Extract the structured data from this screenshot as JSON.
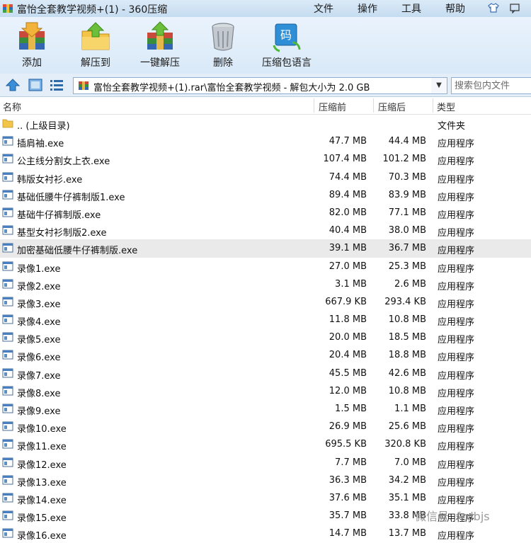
{
  "window": {
    "title": "富怡全套教学视频+(1) - 360压缩",
    "menus": [
      "文件",
      "操作",
      "工具",
      "帮助"
    ]
  },
  "toolbar": [
    {
      "label": "添加",
      "icon": "add-archive-icon"
    },
    {
      "label": "解压到",
      "icon": "extract-to-icon"
    },
    {
      "label": "一键解压",
      "icon": "one-click-extract-icon"
    },
    {
      "label": "删除",
      "icon": "trash-icon"
    },
    {
      "label": "压缩包语言",
      "icon": "archive-language-icon"
    }
  ],
  "address": {
    "path": "富怡全套教学视频+(1).rar\\富怡全套教学视频 - 解包大小为 2.0 GB",
    "search_placeholder": "搜索包内文件"
  },
  "columns": {
    "name": "名称",
    "original": "压缩前",
    "compressed": "压缩后",
    "type": "类型"
  },
  "rows": [
    {
      "name": ".. (上级目录)",
      "original": "",
      "compressed": "",
      "type": "文件夹",
      "kind": "folder"
    },
    {
      "name": "插肩袖.exe",
      "original": "47.7 MB",
      "compressed": "44.4 MB",
      "type": "应用程序",
      "kind": "exe"
    },
    {
      "name": "公主线分割女上衣.exe",
      "original": "107.4 MB",
      "compressed": "101.2 MB",
      "type": "应用程序",
      "kind": "exe"
    },
    {
      "name": "韩版女衬衫.exe",
      "original": "74.4 MB",
      "compressed": "70.3 MB",
      "type": "应用程序",
      "kind": "exe"
    },
    {
      "name": "基础低腰牛仔裤制版1.exe",
      "original": "89.4 MB",
      "compressed": "83.9 MB",
      "type": "应用程序",
      "kind": "exe"
    },
    {
      "name": "基础牛仔裤制版.exe",
      "original": "82.0 MB",
      "compressed": "77.1 MB",
      "type": "应用程序",
      "kind": "exe"
    },
    {
      "name": "基型女衬衫制版2.exe",
      "original": "40.4 MB",
      "compressed": "38.0 MB",
      "type": "应用程序",
      "kind": "exe"
    },
    {
      "name": "加密基础低腰牛仔裤制版.exe",
      "original": "39.1 MB",
      "compressed": "36.7 MB",
      "type": "应用程序",
      "kind": "exe",
      "selected": true
    },
    {
      "name": "录像1.exe",
      "original": "27.0 MB",
      "compressed": "25.3 MB",
      "type": "应用程序",
      "kind": "exe"
    },
    {
      "name": "录像2.exe",
      "original": "3.1 MB",
      "compressed": "2.6 MB",
      "type": "应用程序",
      "kind": "exe"
    },
    {
      "name": "录像3.exe",
      "original": "667.9 KB",
      "compressed": "293.4 KB",
      "type": "应用程序",
      "kind": "exe"
    },
    {
      "name": "录像4.exe",
      "original": "11.8 MB",
      "compressed": "10.8 MB",
      "type": "应用程序",
      "kind": "exe"
    },
    {
      "name": "录像5.exe",
      "original": "20.0 MB",
      "compressed": "18.5 MB",
      "type": "应用程序",
      "kind": "exe"
    },
    {
      "name": "录像6.exe",
      "original": "20.4 MB",
      "compressed": "18.8 MB",
      "type": "应用程序",
      "kind": "exe"
    },
    {
      "name": "录像7.exe",
      "original": "45.5 MB",
      "compressed": "42.6 MB",
      "type": "应用程序",
      "kind": "exe"
    },
    {
      "name": "录像8.exe",
      "original": "12.0 MB",
      "compressed": "10.8 MB",
      "type": "应用程序",
      "kind": "exe"
    },
    {
      "name": "录像9.exe",
      "original": "1.5 MB",
      "compressed": "1.1 MB",
      "type": "应用程序",
      "kind": "exe"
    },
    {
      "name": "录像10.exe",
      "original": "26.9 MB",
      "compressed": "25.6 MB",
      "type": "应用程序",
      "kind": "exe"
    },
    {
      "name": "录像11.exe",
      "original": "695.5 KB",
      "compressed": "320.8 KB",
      "type": "应用程序",
      "kind": "exe"
    },
    {
      "name": "录像12.exe",
      "original": "7.7 MB",
      "compressed": "7.0 MB",
      "type": "应用程序",
      "kind": "exe"
    },
    {
      "name": "录像13.exe",
      "original": "36.3 MB",
      "compressed": "34.2 MB",
      "type": "应用程序",
      "kind": "exe"
    },
    {
      "name": "录像14.exe",
      "original": "37.6 MB",
      "compressed": "35.1 MB",
      "type": "应用程序",
      "kind": "exe"
    },
    {
      "name": "录像15.exe",
      "original": "35.7 MB",
      "compressed": "33.8 MB",
      "type": "应用程序",
      "kind": "exe"
    },
    {
      "name": "录像16.exe",
      "original": "14.7 MB",
      "compressed": "13.7 MB",
      "type": "应用程序",
      "kind": "exe"
    }
  ],
  "watermark": "微信号: fzdbjs"
}
